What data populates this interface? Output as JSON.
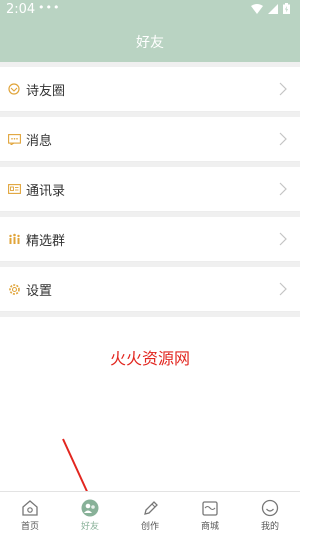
{
  "status_bar": {
    "time": "2:04",
    "dots": "•••"
  },
  "header": {
    "title": "好友"
  },
  "menu": [
    {
      "label": "诗友圈",
      "icon": "emoji-face-icon"
    },
    {
      "label": "消息",
      "icon": "message-icon"
    },
    {
      "label": "通讯录",
      "icon": "contacts-card-icon"
    },
    {
      "label": "精选群",
      "icon": "group-people-icon"
    },
    {
      "label": "设置",
      "icon": "gear-icon"
    }
  ],
  "watermark": "火火资源网",
  "tabs": [
    {
      "label": "首页",
      "icon": "home-icon"
    },
    {
      "label": "好友",
      "icon": "friends-icon",
      "active": true
    },
    {
      "label": "创作",
      "icon": "pen-icon"
    },
    {
      "label": "商城",
      "icon": "shop-icon"
    },
    {
      "label": "我的",
      "icon": "smile-face-icon"
    }
  ],
  "colors": {
    "header_bg": "#b9d3c2",
    "accent": "#88b198",
    "icon_orange": "#e0a43a",
    "annotation_red": "#e2261f"
  }
}
